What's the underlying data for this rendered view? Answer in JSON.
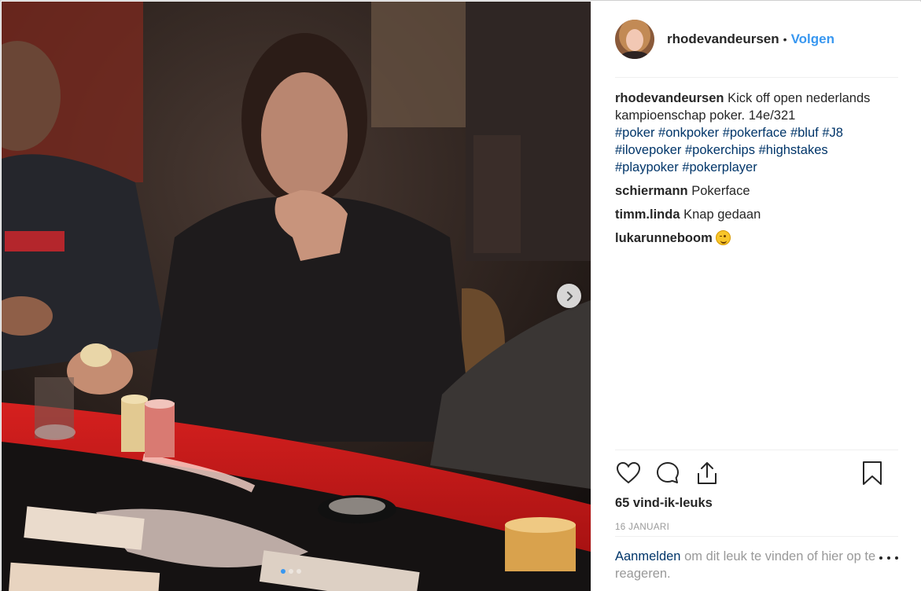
{
  "post": {
    "username": "rhodevandeursen",
    "separator": "•",
    "follow_label": "Volgen",
    "caption_text": "Kick off open nederlands kampioenschap poker. 14e/321",
    "hashtags": [
      "#poker",
      "#onkpoker",
      "#pokerface",
      "#bluf",
      "#J8",
      "#ilovepoker",
      "#pokerchips",
      "#highstakes",
      "#playpoker",
      "#pokerplayer"
    ],
    "comments": [
      {
        "user": "schiermann",
        "text": "Pokerface"
      },
      {
        "user": "timm.linda",
        "text": "Knap gedaan"
      },
      {
        "user": "lukarunneboom",
        "text": "",
        "emoji": "smirk-emoji"
      }
    ],
    "likes": "65 vind-ik-leuks",
    "date": "16 JANUARI",
    "login_link": "Aanmelden",
    "login_text": " om dit leuk te vinden of hier op te reageren."
  },
  "carousel": {
    "slides": 3,
    "active": 1
  },
  "icons": {
    "like": "heart-icon",
    "comment": "comment-icon",
    "share": "share-icon",
    "save": "bookmark-icon",
    "next": "chevron-right-icon",
    "more": "more-icon"
  },
  "colors": {
    "link": "#3897f0",
    "hashtag": "#003569",
    "muted": "#999999",
    "text": "#262626"
  }
}
